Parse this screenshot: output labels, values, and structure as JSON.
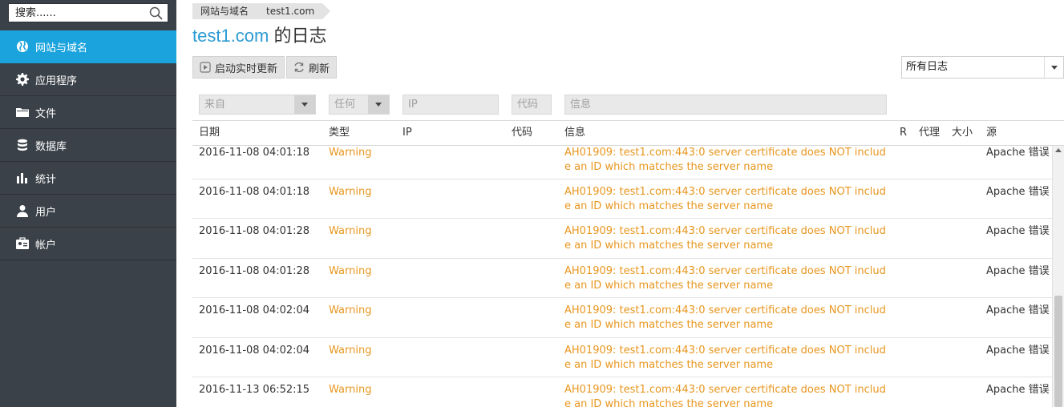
{
  "search": {
    "placeholder": "搜索......"
  },
  "sidebar": {
    "items": [
      {
        "label": "网站与域名",
        "icon": "globe-icon",
        "active": true
      },
      {
        "label": "应用程序",
        "icon": "gear-icon"
      },
      {
        "label": "文件",
        "icon": "folder-icon"
      },
      {
        "label": "数据库",
        "icon": "database-icon"
      },
      {
        "label": "统计",
        "icon": "bar-chart-icon"
      },
      {
        "label": "用户",
        "icon": "user-icon"
      },
      {
        "label": "帐户",
        "icon": "account-icon"
      }
    ]
  },
  "breadcrumb": [
    "网站与域名",
    "test1.com"
  ],
  "page_title": {
    "domain": "test1.com",
    "suffix": " 的日志"
  },
  "toolbar": {
    "realtime_label": "启动实时更新",
    "refresh_label": "刷新"
  },
  "log_select": {
    "value": "所有日志"
  },
  "filters": {
    "from": "来自",
    "type": "任何",
    "ip": "IP",
    "code": "代码",
    "message": "信息"
  },
  "columns": {
    "date": "日期",
    "type": "类型",
    "ip": "IP",
    "code": "代码",
    "message": "信息",
    "r": "R",
    "proxy": "代理",
    "size": "大小",
    "source": "源"
  },
  "rows": [
    {
      "date": "2016-11-08 04:01:18",
      "type": "Warning",
      "message": "AH01909: test1.com:443:0 server certificate does NOT include an ID which matches the server name",
      "source": "Apache 错误"
    },
    {
      "date": "2016-11-08 04:01:18",
      "type": "Warning",
      "message": "AH01909: test1.com:443:0 server certificate does NOT include an ID which matches the server name",
      "source": "Apache 错误"
    },
    {
      "date": "2016-11-08 04:01:28",
      "type": "Warning",
      "message": "AH01909: test1.com:443:0 server certificate does NOT include an ID which matches the server name",
      "source": "Apache 错误"
    },
    {
      "date": "2016-11-08 04:01:28",
      "type": "Warning",
      "message": "AH01909: test1.com:443:0 server certificate does NOT include an ID which matches the server name",
      "source": "Apache 错误"
    },
    {
      "date": "2016-11-08 04:02:04",
      "type": "Warning",
      "message": "AH01909: test1.com:443:0 server certificate does NOT include an ID which matches the server name",
      "source": "Apache 错误"
    },
    {
      "date": "2016-11-08 04:02:04",
      "type": "Warning",
      "message": "AH01909: test1.com:443:0 server certificate does NOT include an ID which matches the server name",
      "source": "Apache 错误"
    },
    {
      "date": "2016-11-13 06:52:15",
      "type": "Warning",
      "message": "AH01909: test1.com:443:0 server certificate does NOT include an ID which matches the server name",
      "source": "Apache 错误"
    }
  ],
  "colors": {
    "accent": "#1aa3dd",
    "sidebar_bg": "#3a4148",
    "warning": "#e8961e",
    "domain_link": "#2d9bd3"
  }
}
